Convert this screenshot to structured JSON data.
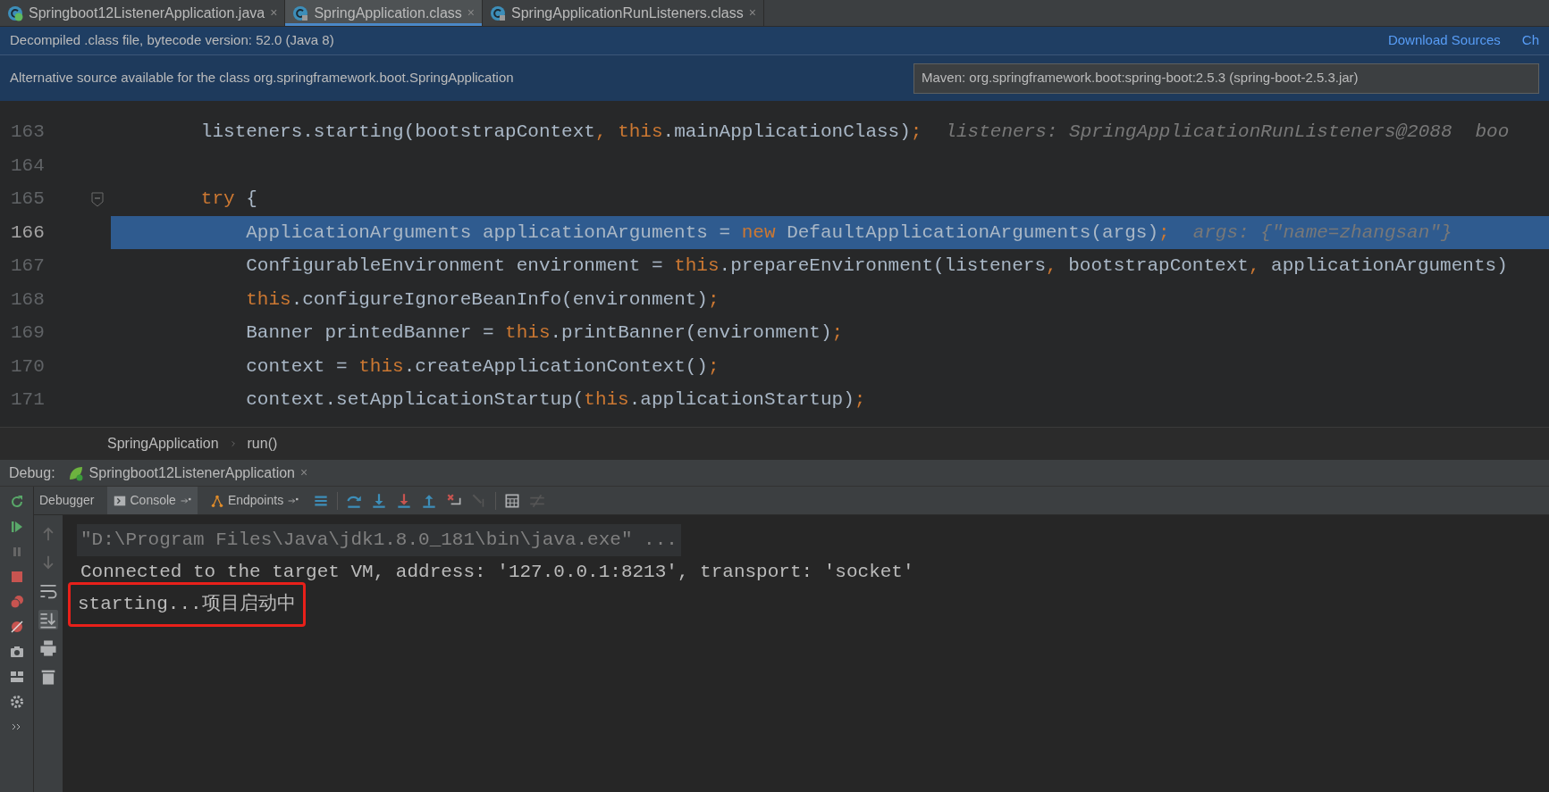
{
  "editor_tabs": [
    {
      "label": "Springboot12ListenerApplication.java",
      "selected": false,
      "kind": "java",
      "close": "×"
    },
    {
      "label": "SpringApplication.class",
      "selected": true,
      "kind": "class",
      "close": "×"
    },
    {
      "label": "SpringApplicationRunListeners.class",
      "selected": false,
      "kind": "class",
      "close": "×"
    }
  ],
  "decompiled_banner": {
    "text": "Decompiled .class file, bytecode version: 52.0 (Java 8)",
    "links": [
      "Download Sources",
      "Ch"
    ]
  },
  "source_banner": {
    "text": "Alternative source available for the class org.springframework.boot.SpringApplication",
    "dropdown": "Maven: org.springframework.boot:spring-boot:2.5.3 (spring-boot-2.5.3.jar)"
  },
  "code_lines": [
    {
      "number": "163",
      "selected": false,
      "segments": [
        {
          "kind": "plain",
          "text": "        listeners.starting(bootstrapContext"
        },
        {
          "kind": "keyword",
          "text": ","
        },
        {
          "kind": "keyword",
          "text": " this"
        },
        {
          "kind": "plain",
          "text": ".mainApplicationClass)"
        },
        {
          "kind": "keyword",
          "text": ";"
        },
        {
          "kind": "hint",
          "text": "listeners: SpringApplicationRunListeners@2088"
        },
        {
          "kind": "hint",
          "text": "boo"
        }
      ]
    },
    {
      "number": "164",
      "selected": false
    },
    {
      "number": "165",
      "selected": false,
      "fold": true,
      "segments": [
        {
          "kind": "keyword",
          "text": "        try"
        },
        {
          "kind": "plain",
          "text": " {"
        }
      ]
    },
    {
      "number": "166",
      "selected": true,
      "segments": [
        {
          "kind": "plain",
          "text": "            ApplicationArguments applicationArguments = "
        },
        {
          "kind": "keyword",
          "text": "new"
        },
        {
          "kind": "plain",
          "text": " DefaultApplicationArguments(args)"
        },
        {
          "kind": "keyword",
          "text": ";"
        },
        {
          "kind": "hint",
          "text": "args: {\"name=zhangsan\"}"
        }
      ]
    },
    {
      "number": "167",
      "selected": false,
      "segments": [
        {
          "kind": "plain",
          "text": "            ConfigurableEnvironment environment = "
        },
        {
          "kind": "keyword",
          "text": "this"
        },
        {
          "kind": "plain",
          "text": ".prepareEnvironment(listeners"
        },
        {
          "kind": "keyword",
          "text": ","
        },
        {
          "kind": "plain",
          "text": " bootstrapContext"
        },
        {
          "kind": "keyword",
          "text": ","
        },
        {
          "kind": "plain",
          "text": " applicationArguments)"
        }
      ]
    },
    {
      "number": "168",
      "selected": false,
      "segments": [
        {
          "kind": "keyword",
          "text": "            this"
        },
        {
          "kind": "plain",
          "text": ".configureIgnoreBeanInfo(environment)"
        },
        {
          "kind": "keyword",
          "text": ";"
        }
      ]
    },
    {
      "number": "169",
      "selected": false,
      "segments": [
        {
          "kind": "plain",
          "text": "            Banner printedBanner = "
        },
        {
          "kind": "keyword",
          "text": "this"
        },
        {
          "kind": "plain",
          "text": ".printBanner(environment)"
        },
        {
          "kind": "keyword",
          "text": ";"
        }
      ]
    },
    {
      "number": "170",
      "selected": false,
      "segments": [
        {
          "kind": "plain",
          "text": "            context = "
        },
        {
          "kind": "keyword",
          "text": "this"
        },
        {
          "kind": "plain",
          "text": ".createApplicationContext()"
        },
        {
          "kind": "keyword",
          "text": ";"
        }
      ]
    },
    {
      "number": "171",
      "selected": false,
      "segments": [
        {
          "kind": "plain",
          "text": "            context.setApplicationStartup("
        },
        {
          "kind": "keyword",
          "text": "this"
        },
        {
          "kind": "plain",
          "text": ".applicationStartup)"
        },
        {
          "kind": "keyword",
          "text": ";"
        }
      ]
    }
  ],
  "breadcrumb": [
    "SpringApplication",
    "run()"
  ],
  "debug_panel": {
    "label": "Debug:",
    "session": "Springboot12ListenerApplication",
    "session_close": "×",
    "tabs": [
      {
        "label": "Debugger",
        "selected": false
      },
      {
        "label": "Console",
        "selected": true,
        "pin": true
      },
      {
        "label": "Endpoints",
        "selected": false,
        "pin": true
      }
    ]
  },
  "console_lines": [
    {
      "kind": "command",
      "text": "\"D:\\Program Files\\Java\\jdk1.8.0_181\\bin\\java.exe\" ...",
      "boxed": false
    },
    {
      "kind": "output",
      "text": "Connected to the target VM, address: '127.0.0.1:8213', transport: 'socket'",
      "boxed": false
    },
    {
      "kind": "output",
      "text": "starting...项目启动中",
      "boxed": true
    }
  ]
}
